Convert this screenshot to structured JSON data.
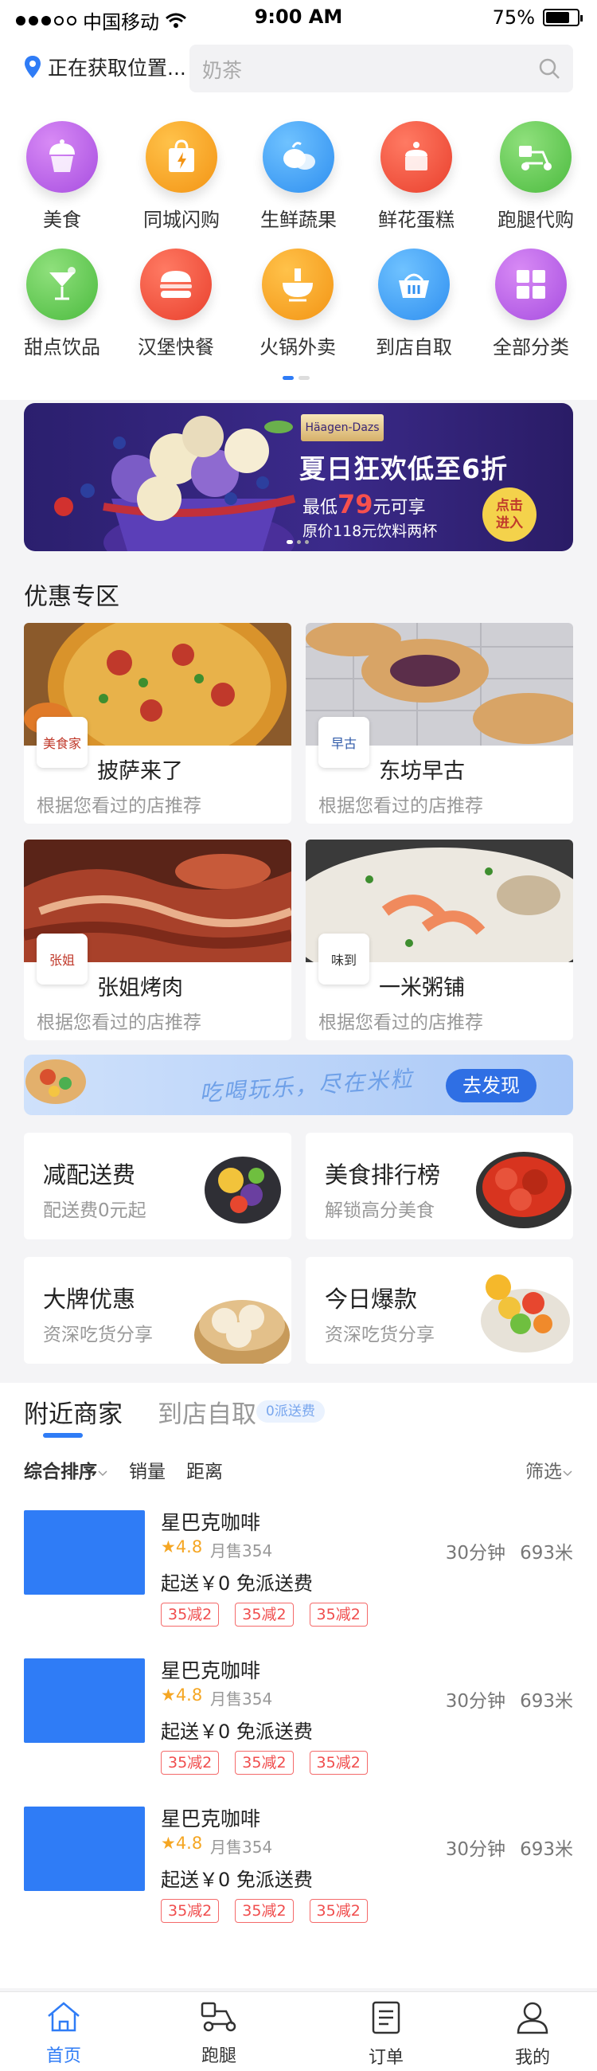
{
  "status": {
    "carrier": "中国移动",
    "time": "9:00 AM",
    "battery": "75%",
    "battery_level": 0.75
  },
  "header": {
    "location": "正在获取位置...",
    "search_placeholder": "奶茶"
  },
  "categories": [
    {
      "label": "美食",
      "icon": "cupcake-icon",
      "color": "#b25ae6"
    },
    {
      "label": "同城闪购",
      "icon": "shopping-bag-icon",
      "color": "#f7a21b"
    },
    {
      "label": "生鲜蔬果",
      "icon": "vegetable-icon",
      "color": "#3c9ef5"
    },
    {
      "label": "鲜花蛋糕",
      "icon": "cake-icon",
      "color": "#f2533b"
    },
    {
      "label": "跑腿代购",
      "icon": "scooter-icon",
      "color": "#5ac951"
    },
    {
      "label": "甜点饮品",
      "icon": "cocktail-icon",
      "color": "#5ac951"
    },
    {
      "label": "汉堡快餐",
      "icon": "burger-icon",
      "color": "#f2533b"
    },
    {
      "label": "火锅外卖",
      "icon": "hotpot-icon",
      "color": "#f7a21b"
    },
    {
      "label": "到店自取",
      "icon": "basket-icon",
      "color": "#3c9ef5"
    },
    {
      "label": "全部分类",
      "icon": "grid-icon",
      "color": "#b25ae6"
    }
  ],
  "banner": {
    "brand": "Häagen-Dazs",
    "headline": "夏日狂欢低至6折",
    "price_prefix": "最低",
    "price": "79",
    "price_suffix": "元可享",
    "original": "原价118元饮料两杯",
    "cta_line1": "点击",
    "cta_line2": "进入"
  },
  "deals": {
    "title": "优惠专区",
    "items": [
      {
        "name": "披萨来了",
        "sub": "根据您看过的店推荐",
        "logo": "美食家"
      },
      {
        "name": "东坊早古",
        "sub": "根据您看过的店推荐",
        "logo": "早古"
      },
      {
        "name": "张姐烤肉",
        "sub": "根据您看过的店推荐",
        "logo": "张姐"
      },
      {
        "name": "一米粥铺",
        "sub": "根据您看过的店推荐",
        "logo": "味到"
      }
    ]
  },
  "promo": {
    "text": "吃喝玩乐，尽在米粒",
    "button": "去发现"
  },
  "features": [
    {
      "title": "减配送费",
      "sub": "配送费0元起"
    },
    {
      "title": "美食排行榜",
      "sub": "解锁高分美食"
    },
    {
      "title": "大牌优惠",
      "sub": "资深吃货分享"
    },
    {
      "title": "今日爆款",
      "sub": "资深吃货分享"
    }
  ],
  "nearby": {
    "tab_active": "附近商家",
    "tab_other": "到店自取",
    "tag": "0派送费",
    "sort_default": "综合排序",
    "sort_sales": "销量",
    "sort_distance": "距离",
    "filter": "筛选"
  },
  "shops": [
    {
      "name": "星巴克咖啡",
      "rating": "★4.8",
      "sold": "月售354",
      "time": "30分钟",
      "distance": "693米",
      "fee": "起送￥0  免派送费",
      "badges": [
        "35减2",
        "35减2",
        "35减2"
      ]
    },
    {
      "name": "星巴克咖啡",
      "rating": "★4.8",
      "sold": "月售354",
      "time": "30分钟",
      "distance": "693米",
      "fee": "起送￥0  免派送费",
      "badges": [
        "35减2",
        "35减2",
        "35减2"
      ]
    },
    {
      "name": "星巴克咖啡",
      "rating": "★4.8",
      "sold": "月售354",
      "time": "30分钟",
      "distance": "693米",
      "fee": "起送￥0  免派送费",
      "badges": [
        "35减2",
        "35减2",
        "35减2"
      ]
    }
  ],
  "tabbar": [
    {
      "label": "首页",
      "icon": "home-icon",
      "active": true
    },
    {
      "label": "跑腿",
      "icon": "errand-icon",
      "active": false
    },
    {
      "label": "订单",
      "icon": "order-icon",
      "active": false
    },
    {
      "label": "我的",
      "icon": "user-icon",
      "active": false
    }
  ],
  "colors": {
    "accent": "#2f7cf6",
    "badge": "#f04d4d",
    "rating": "#f5a623"
  }
}
